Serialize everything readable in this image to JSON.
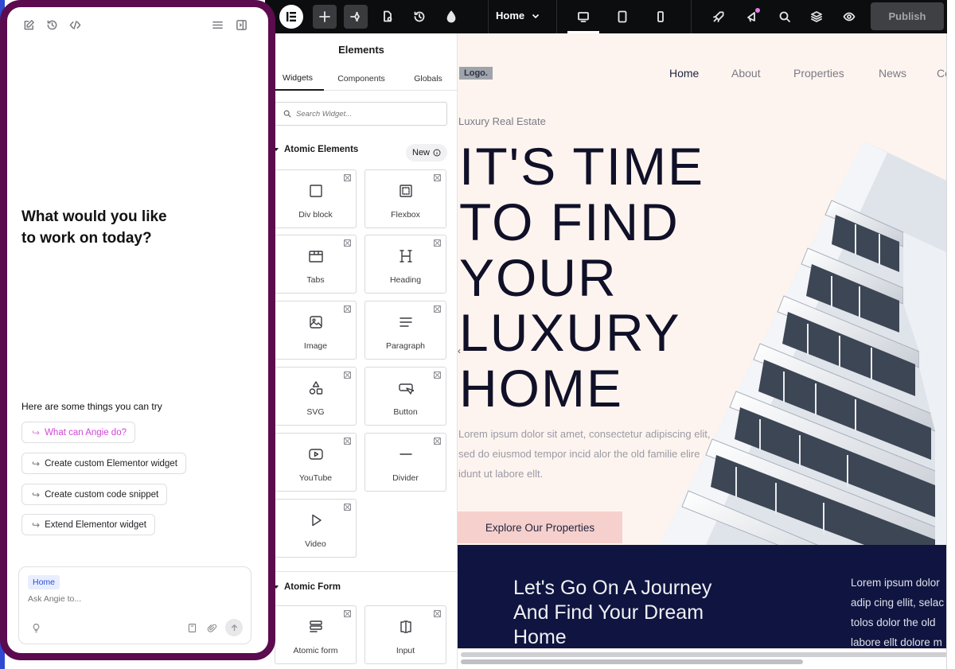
{
  "topbar": {
    "page_selector": "Home",
    "publish_label": "Publish",
    "icons": [
      "elementor-logo-icon",
      "add-icon",
      "structure-icon",
      "page-settings-icon",
      "history-icon",
      "theme-style-icon",
      "chevron-down-icon",
      "desktop-icon",
      "tablet-icon",
      "mobile-icon",
      "rocket-icon",
      "notifications-icon",
      "search-icon",
      "layers-icon",
      "preview-eye-icon"
    ]
  },
  "angie": {
    "toolbar_icons": [
      "new-chat-icon",
      "history-icon",
      "code-icon",
      "menu-icon",
      "panel-toggle-icon"
    ],
    "heading_line1": "What would you like",
    "heading_line2": "to work on today?",
    "try_label": "Here are some things you can try",
    "suggestions": [
      {
        "label": "What can Angie do?"
      },
      {
        "label": "Create custom Elementor widget"
      },
      {
        "label": "Create custom code snippet"
      },
      {
        "label": "Extend Elementor widget"
      }
    ],
    "context_chip": "Home",
    "input_placeholder": "Ask Angie to...",
    "accent_color": "#5b0b4e"
  },
  "elements_panel": {
    "title": "Elements",
    "tabs": [
      "Widgets",
      "Components",
      "Globals"
    ],
    "active_tab": "Widgets",
    "search_placeholder": "Search Widget...",
    "section_atomic": "Atomic Elements",
    "new_badge": "New",
    "widgets": [
      "Div block",
      "Flexbox",
      "Tabs",
      "Heading",
      "Image",
      "Paragraph",
      "SVG",
      "Button",
      "YouTube",
      "Divider",
      "Video"
    ],
    "section_form": "Atomic Form",
    "form_widgets": [
      "Atomic form",
      "Input"
    ]
  },
  "site": {
    "logo": "Logo.",
    "nav": [
      "Home",
      "About",
      "Properties",
      "News",
      "Co"
    ],
    "eyebrow": "Luxury Real Estate",
    "hero_lines": [
      "IT'S TIME",
      "TO FIND",
      "YOUR",
      "LUXURY",
      "HOME"
    ],
    "body_lines": [
      "Lorem ipsum dolor sit amet, consectetur adipiscing elit,",
      "sed do eiusmod tempor incid alor the old familie elire",
      "idunt ut labore ellt."
    ],
    "cta": "Explore Our Properties",
    "journey_lines": [
      "Let's Go On A Journey",
      "And Find Your Dream",
      "Home"
    ],
    "side_text": [
      "Lorem ipsum dolor",
      "adip cing ellit, selac",
      "tolos dolor the old",
      "labore ellt dolore m"
    ],
    "navy_color": "#0f1540",
    "cta_color": "#f6d0cc"
  }
}
